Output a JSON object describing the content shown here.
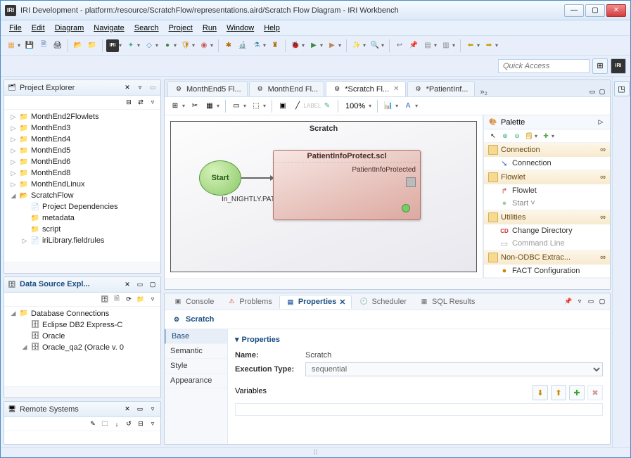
{
  "window": {
    "title": "IRI Development - platform:/resource/ScratchFlow/representations.aird/Scratch Flow Diagram - IRI Workbench",
    "app_badge": "IRI"
  },
  "menu": [
    "File",
    "Edit",
    "Diagram",
    "Navigate",
    "Search",
    "Project",
    "Run",
    "Window",
    "Help"
  ],
  "quick_access_placeholder": "Quick Access",
  "project_explorer": {
    "title": "Project Explorer",
    "items": [
      {
        "level": 1,
        "twisty": "▷",
        "icon": "📁",
        "label": "MonthEnd2Flowlets"
      },
      {
        "level": 1,
        "twisty": "▷",
        "icon": "📁",
        "label": "MonthEnd3"
      },
      {
        "level": 1,
        "twisty": "▷",
        "icon": "📁",
        "label": "MonthEnd4"
      },
      {
        "level": 1,
        "twisty": "▷",
        "icon": "📁",
        "label": "MonthEnd5"
      },
      {
        "level": 1,
        "twisty": "▷",
        "icon": "📁",
        "label": "MonthEnd6"
      },
      {
        "level": 1,
        "twisty": "▷",
        "icon": "📁",
        "label": "MonthEnd8"
      },
      {
        "level": 1,
        "twisty": "▷",
        "icon": "📁",
        "label": "MonthEndLinux"
      },
      {
        "level": 1,
        "twisty": "◢",
        "icon": "📂",
        "label": "ScratchFlow"
      },
      {
        "level": 2,
        "twisty": "",
        "icon": "📄",
        "label": "Project Dependencies"
      },
      {
        "level": 2,
        "twisty": "",
        "icon": "📁",
        "label": "metadata"
      },
      {
        "level": 2,
        "twisty": "",
        "icon": "📁",
        "label": "script"
      },
      {
        "level": 2,
        "twisty": "▷",
        "icon": "📄",
        "label": "iriLibrary.fieldrules"
      }
    ]
  },
  "data_source_explorer": {
    "title": "Data Source Expl...",
    "items": [
      {
        "level": 1,
        "twisty": "◢",
        "icon": "📁",
        "label": "Database Connections"
      },
      {
        "level": 2,
        "twisty": "",
        "icon": "🗄",
        "label": "Eclipse DB2 Express-C"
      },
      {
        "level": 2,
        "twisty": "",
        "icon": "🗄",
        "label": "Oracle"
      },
      {
        "level": 2,
        "twisty": "◢",
        "icon": "🗄",
        "label": "Oracle_qa2 (Oracle v. 0"
      }
    ]
  },
  "remote_systems": {
    "title": "Remote Systems"
  },
  "editor": {
    "tabs": [
      {
        "label": "MonthEnd5 Fl...",
        "active": false,
        "dirty": false
      },
      {
        "label": "MonthEnd Fl...",
        "active": false,
        "dirty": false
      },
      {
        "label": "*Scratch Fl...",
        "active": true,
        "dirty": true,
        "closeable": true
      },
      {
        "label": "*PatientInf...",
        "active": false,
        "dirty": true
      }
    ],
    "overflow": "»₂",
    "zoom": "100%",
    "canvas_title": "Scratch",
    "start_label": "Start",
    "task_title": "PatientInfoProtect.scl",
    "task_output": "PatientInfoProtected",
    "input_label": "In_NIGHTLY.PATIENT_RECORD"
  },
  "palette": {
    "title": "Palette",
    "drawers": [
      {
        "title": "Connection",
        "items": [
          {
            "icon": "🔗",
            "label": "Connection"
          }
        ]
      },
      {
        "title": "Flowlet",
        "items": [
          {
            "icon": "↪",
            "label": "Flowlet"
          },
          {
            "icon": "●",
            "label": "Start   ˅"
          }
        ]
      },
      {
        "title": "Utilities",
        "items": [
          {
            "icon": "CD",
            "label": "Change Directory"
          },
          {
            "icon": "▭",
            "label": "Command Line",
            "dim": true
          }
        ]
      },
      {
        "title": "Non-ODBC Extrac...",
        "items": [
          {
            "icon": "●",
            "label": "FACT Configuration",
            "trunc": true
          }
        ]
      }
    ]
  },
  "bottom": {
    "tabs": [
      "Console",
      "Problems",
      "Properties",
      "Scheduler",
      "SQL Results"
    ],
    "active_tab": "Properties",
    "title": "Scratch",
    "side_tabs": [
      "Base",
      "Semantic",
      "Style",
      "Appearance"
    ],
    "side_tab_sel": "Base",
    "section": "Properties",
    "name_label": "Name:",
    "name_value": "Scratch",
    "exec_label": "Execution Type:",
    "exec_value": "sequential",
    "variables_label": "Variables"
  }
}
